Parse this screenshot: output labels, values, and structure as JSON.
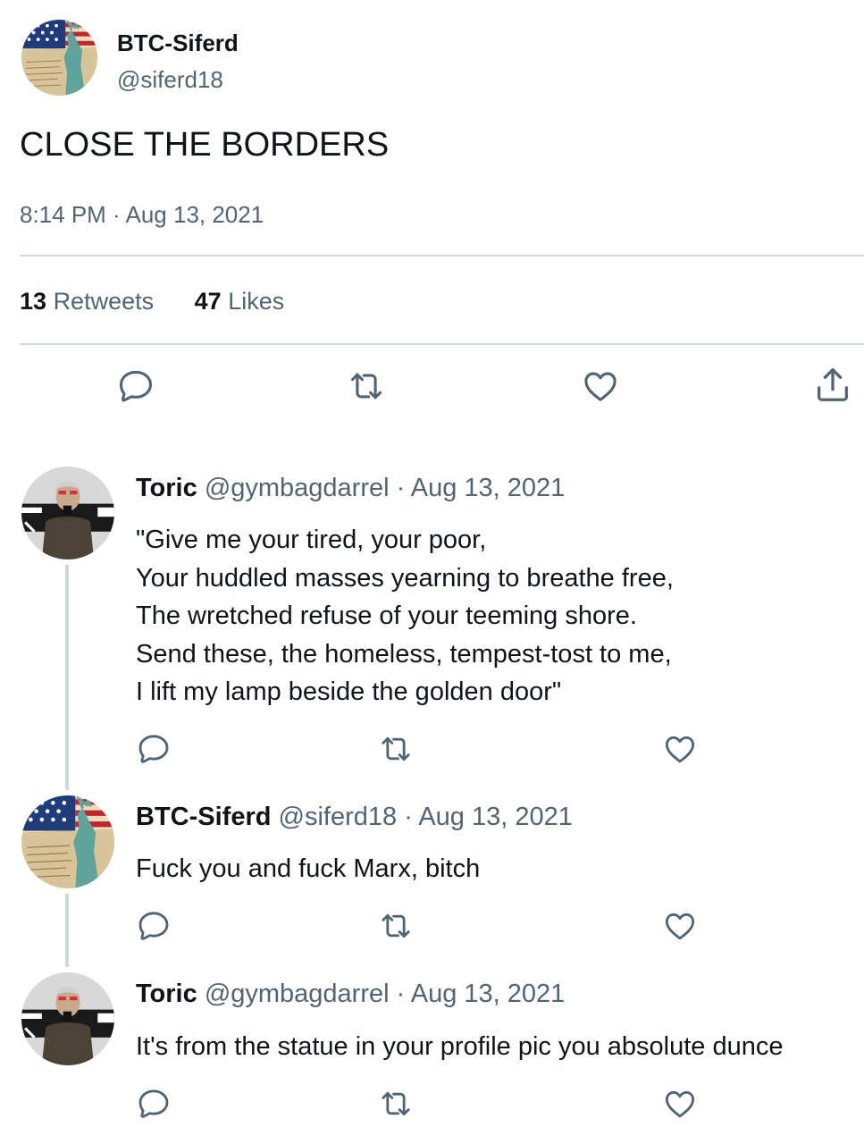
{
  "tweet": {
    "author_name": "BTC-Siferd",
    "author_handle": "@siferd18",
    "text": "CLOSE THE BORDERS",
    "timestamp": "8:14 PM · Aug 13, 2021",
    "retweets_count": "13",
    "retweets_label": "Retweets",
    "likes_count": "47",
    "likes_label": "Likes"
  },
  "replies": [
    {
      "name": "Toric",
      "handle": "@gymbagdarrel",
      "date": "· Aug 13, 2021",
      "lines": [
        "\"Give me your tired, your poor,",
        "Your huddled masses yearning to breathe free,",
        "The wretched refuse of your teeming shore.",
        "Send these, the homeless, tempest-tost to me,",
        "I lift my lamp beside the golden door\""
      ]
    },
    {
      "name": "BTC-Siferd",
      "handle": "@siferd18",
      "date": "· Aug 13, 2021",
      "lines": [
        "Fuck you and fuck Marx, bitch"
      ]
    },
    {
      "name": "Toric",
      "handle": "@gymbagdarrel",
      "date": "· Aug 13, 2021",
      "lines": [
        "It's from the statue in your profile pic you absolute dunce"
      ]
    }
  ],
  "icons": {
    "reply": "reply-icon",
    "retweet": "retweet-icon",
    "like": "heart-icon",
    "share": "share-icon"
  },
  "colors": {
    "text": "#0f1419",
    "muted": "#536471",
    "divider": "#cfd9de"
  }
}
